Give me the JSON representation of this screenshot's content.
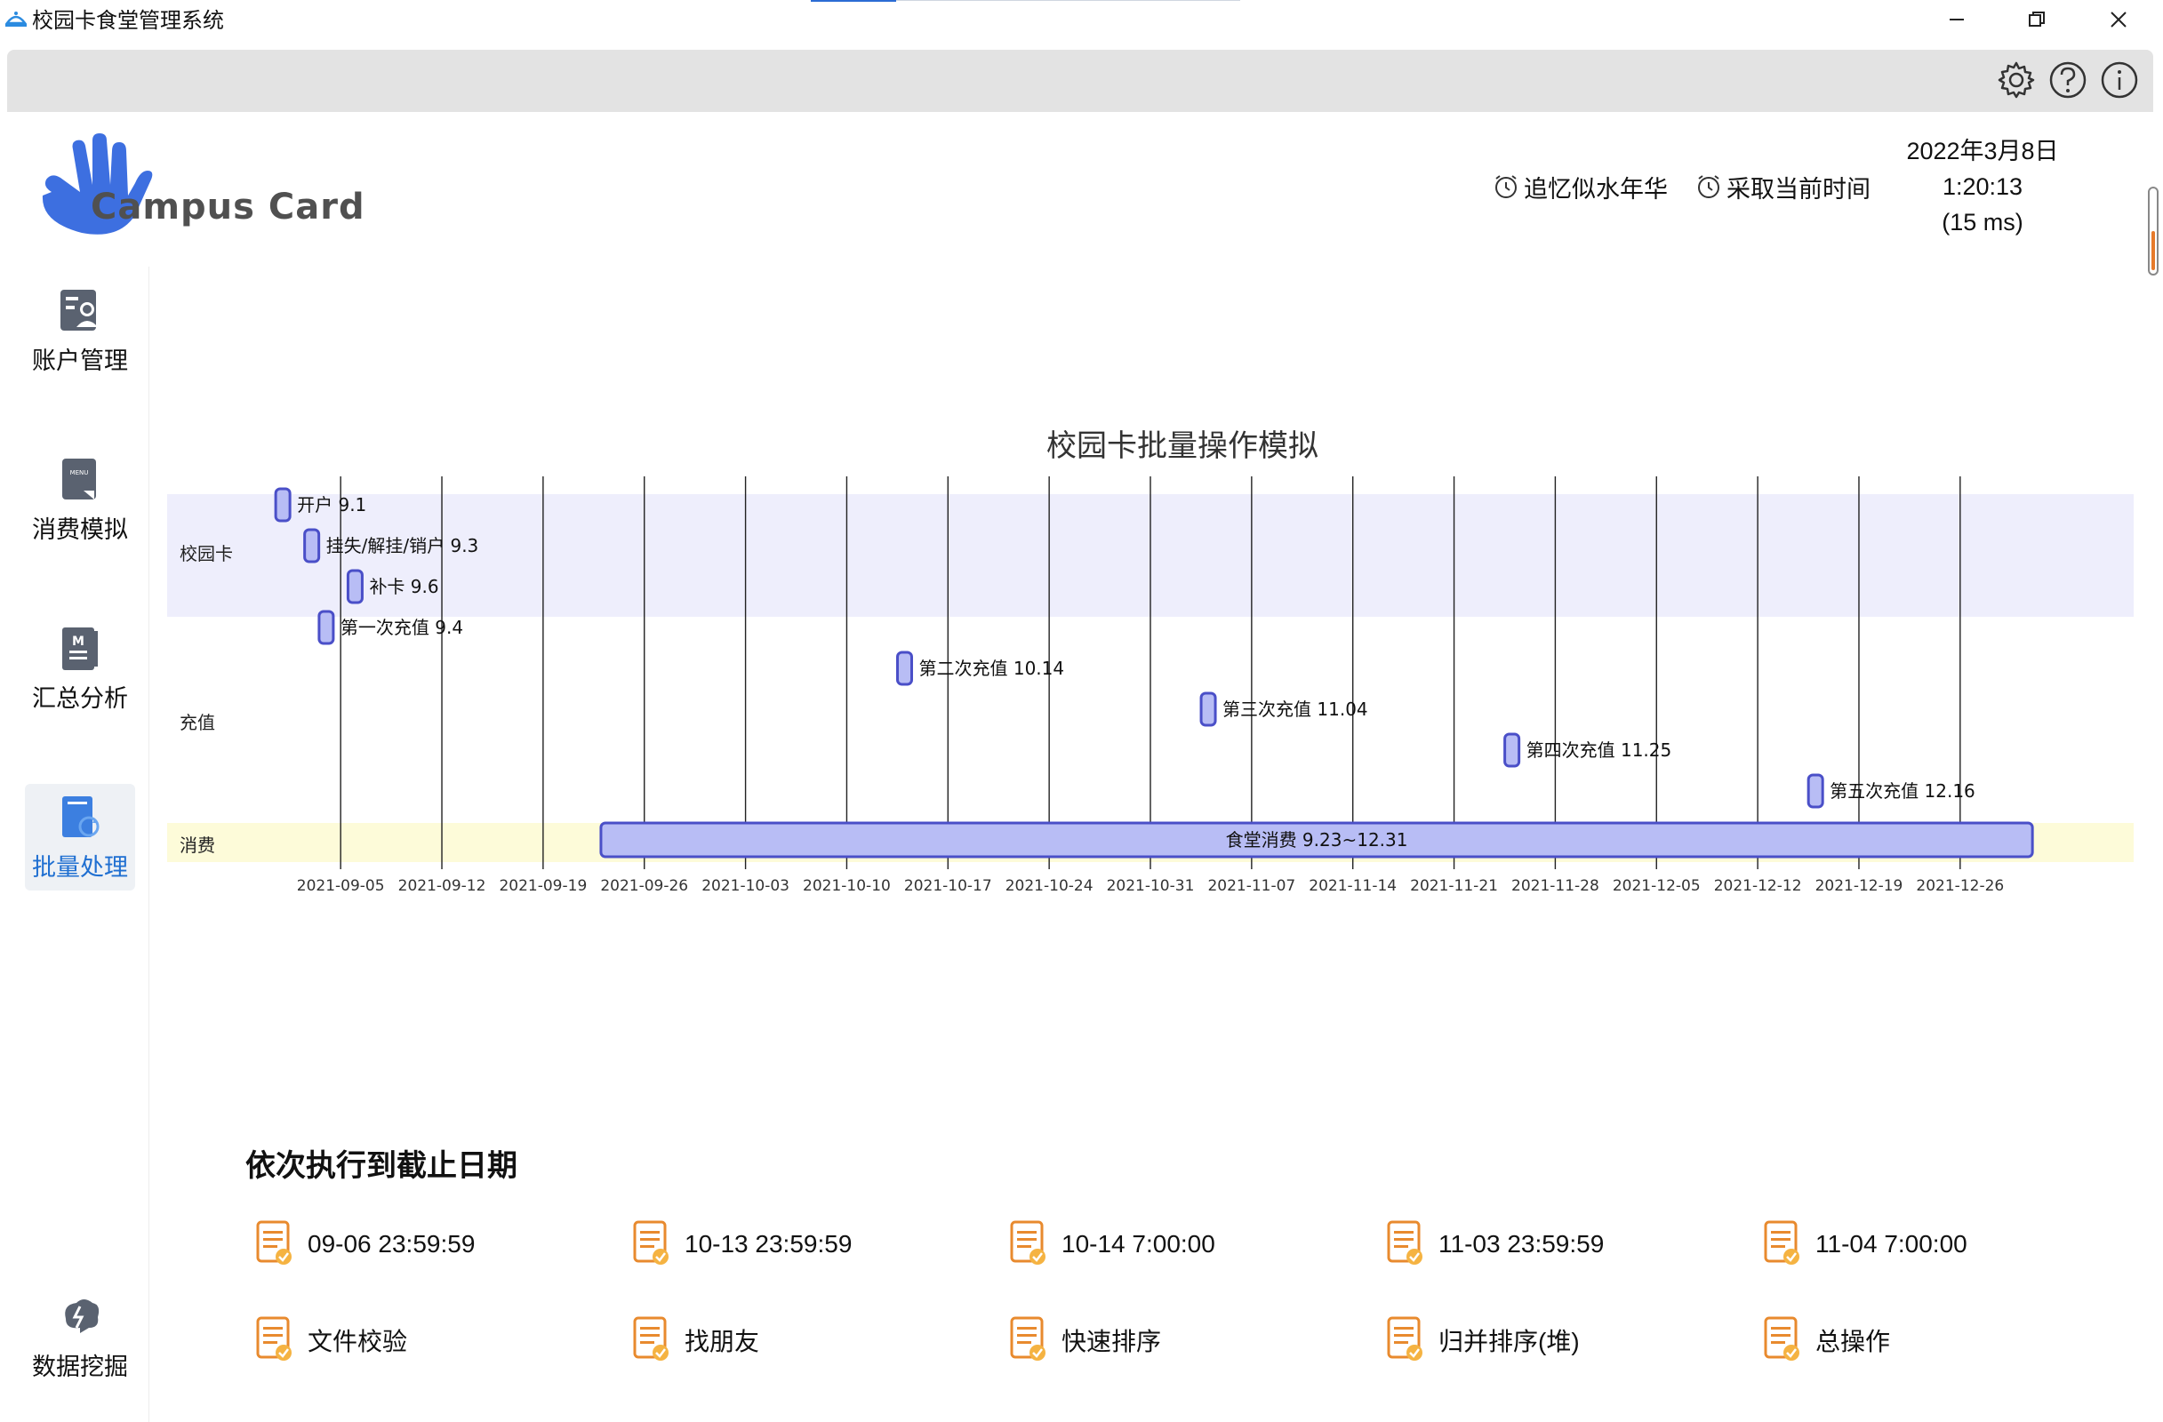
{
  "window": {
    "title": "校园卡食堂管理系统",
    "controls": [
      "minimize-icon",
      "restore-icon",
      "close-icon"
    ]
  },
  "toolbar": {
    "icons": [
      "gear-icon",
      "help-icon",
      "info-icon"
    ]
  },
  "header": {
    "logo_text": "Campus Card",
    "links": [
      {
        "label": "追忆似水年华",
        "icon": "alarm-clock-icon"
      },
      {
        "label": "采取当前时间",
        "icon": "alarm-clock-icon"
      }
    ],
    "clock": {
      "date": "2022年3月8日",
      "time": "1:20:13",
      "latency": "(15 ms)"
    }
  },
  "sidebar": {
    "items": [
      {
        "label": "账户管理",
        "icon": "account-management-icon",
        "active": false
      },
      {
        "label": "消费模拟",
        "icon": "menu-card-icon",
        "active": false
      },
      {
        "label": "汇总分析",
        "icon": "summary-book-icon",
        "active": false
      },
      {
        "label": "批量处理",
        "icon": "batch-process-icon",
        "active": true
      },
      {
        "label": "数据挖掘",
        "icon": "data-mining-icon",
        "active": false
      }
    ]
  },
  "chart_data": {
    "type": "timeline",
    "title": "校园卡批量操作模拟",
    "lanes": [
      {
        "name": "校园卡",
        "background": "#eeeefc"
      },
      {
        "name": "充值",
        "background": "#ffffff"
      },
      {
        "name": "消费",
        "background": "#fdfbd9"
      }
    ],
    "x_ticks": [
      "2021-09-05",
      "2021-09-12",
      "2021-09-19",
      "2021-09-26",
      "2021-10-03",
      "2021-10-10",
      "2021-10-17",
      "2021-10-24",
      "2021-10-31",
      "2021-11-07",
      "2021-11-14",
      "2021-11-21",
      "2021-11-28",
      "2021-12-05",
      "2021-12-12",
      "2021-12-19",
      "2021-12-26"
    ],
    "x_range": [
      "2021-08-24",
      "2022-01-07"
    ],
    "events": [
      {
        "lane": "校园卡",
        "date": "2021-09-01",
        "label": "开户 9.1"
      },
      {
        "lane": "校园卡",
        "date": "2021-09-03",
        "label": "挂失/解挂/销户 9.3"
      },
      {
        "lane": "校园卡",
        "date": "2021-09-06",
        "label": "补卡 9.6"
      },
      {
        "lane": "充值",
        "date": "2021-09-04",
        "label": "第一次充值 9.4"
      },
      {
        "lane": "充值",
        "date": "2021-10-14",
        "label": "第二次充值 10.14"
      },
      {
        "lane": "充值",
        "date": "2021-11-04",
        "label": "第三次充值 11.04"
      },
      {
        "lane": "充值",
        "date": "2021-11-25",
        "label": "第四次充值 11.25"
      },
      {
        "lane": "充值",
        "date": "2021-12-16",
        "label": "第五次充值 12.16"
      }
    ],
    "ranges": [
      {
        "lane": "消费",
        "start": "2021-09-23",
        "end": "2021-12-31",
        "label": "食堂消费 9.23~12.31"
      }
    ],
    "grid": true,
    "colors": {
      "marker_fill": "#b8bdf5",
      "marker_stroke": "#4a4fc8"
    }
  },
  "batch": {
    "title": "依次执行到截止日期",
    "row1": [
      "09-06 23:59:59",
      "10-13 23:59:59",
      "10-14 7:00:00",
      "11-03 23:59:59",
      "11-04 7:00:00"
    ],
    "row2": [
      "文件校验",
      "找朋友",
      "快速排序",
      "归并排序(堆)",
      "总操作"
    ],
    "icon": "document-check-icon"
  }
}
